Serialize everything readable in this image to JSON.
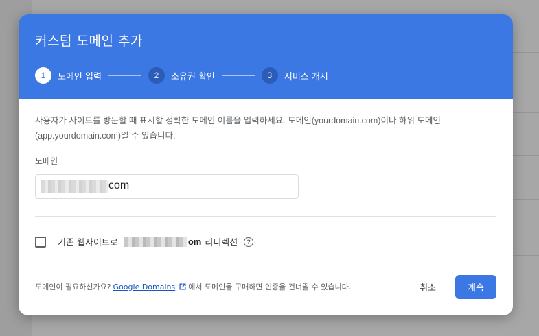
{
  "dialog": {
    "title": "커스텀 도메인 추가",
    "steps": [
      {
        "number": "1",
        "label": "도메인 입력",
        "state": "active"
      },
      {
        "number": "2",
        "label": "소유권 확인",
        "state": "inactive"
      },
      {
        "number": "3",
        "label": "서비스 개시",
        "state": "inactive"
      }
    ],
    "description": "사용자가 사이트를 방문할 때 표시할 정확한 도메인 이름을 입력하세요. 도메인(yourdomain.com)이나 하위 도메인(app.yourdomain.com)일 수 있습니다.",
    "domain_field": {
      "label": "도메인",
      "visible_suffix": "com"
    },
    "redirect": {
      "label_prefix": "기존 웹사이트로",
      "domain_suffix": "om",
      "label_suffix": "리디렉션",
      "checked": false
    },
    "footer": {
      "note_prefix": "도메인이 필요하신가요?",
      "link_text": "Google Domains",
      "note_suffix": "에서 도메인을 구매하면 인증을 건너뛸 수 있습니다.",
      "cancel_label": "취소",
      "continue_label": "계속"
    }
  },
  "colors": {
    "header": "#3c78e4",
    "primary_button": "#3c78e4",
    "link": "#1a56c4"
  },
  "icons": {
    "help": "help-circle-icon",
    "external": "open-in-new-icon"
  }
}
